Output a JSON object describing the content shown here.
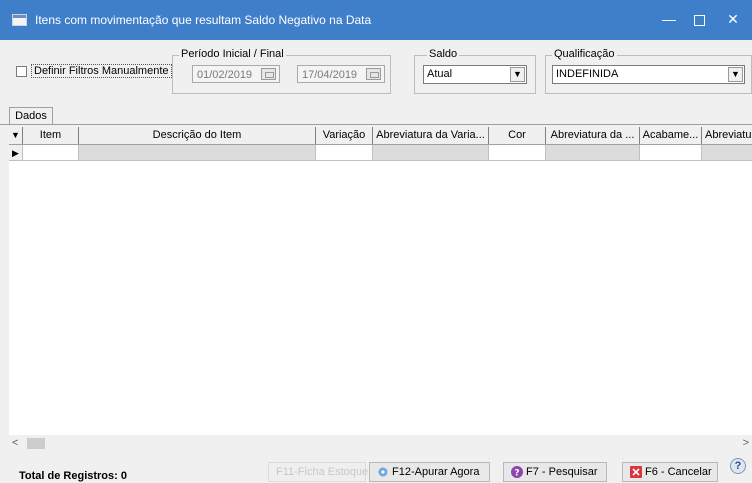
{
  "window": {
    "title": "Itens com movimentação que resultam Saldo Negativo na Data",
    "min": "—",
    "close": "✕"
  },
  "filters": {
    "manual_label": "Definir Filtros Manualmente",
    "period_legend": "Período Inicial / Final",
    "date_start": "01/02/2019",
    "date_end": "17/04/2019",
    "saldo_legend": "Saldo",
    "saldo_value": "Atual",
    "qual_legend": "Qualificação",
    "qual_value": "INDEFINIDA",
    "dropdown_arrow": "▼"
  },
  "tab": {
    "label": "Dados"
  },
  "grid": {
    "filter_marker": "▼",
    "row_marker": "▶",
    "columns": [
      "Item",
      "Descrição do Item",
      "Variação",
      "Abreviatura da Varia...",
      "Cor",
      "Abreviatura da ...",
      "Acabame...",
      "Abreviatu"
    ]
  },
  "scroll": {
    "left": "<",
    "right": ">"
  },
  "status": {
    "total": "Total de Registros: 0",
    "btn_ficha": "F11-Ficha Estoque",
    "btn_apurar": "F12-Apurar Agora",
    "btn_pesquisar": "F7 - Pesquisar",
    "btn_cancelar": "F6 - Cancelar",
    "help": "?"
  },
  "colors": {
    "titlebar": "#3f7ec9",
    "help": "#8e44ad",
    "cancel": "#d9363e",
    "gear": "#6fa8dc"
  }
}
